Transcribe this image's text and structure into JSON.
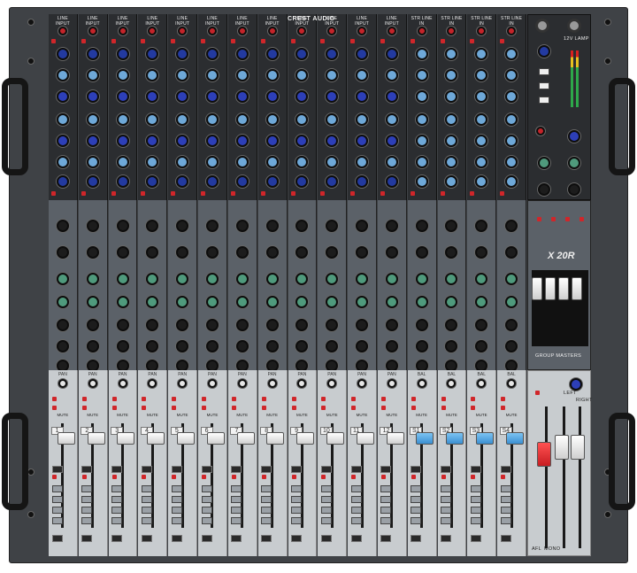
{
  "brand": {
    "logo_text": "CREST AUDIO",
    "model": "X 20R",
    "group_masters_label": "GROUP MASTERS"
  },
  "mono_channels": [
    {
      "number": "1",
      "top_label": "LINE INPUT",
      "pan_label": "PAN",
      "mute_label": "MUTE"
    },
    {
      "number": "2",
      "top_label": "LINE INPUT",
      "pan_label": "PAN",
      "mute_label": "MUTE"
    },
    {
      "number": "3",
      "top_label": "LINE INPUT",
      "pan_label": "PAN",
      "mute_label": "MUTE"
    },
    {
      "number": "4",
      "top_label": "LINE INPUT",
      "pan_label": "PAN",
      "mute_label": "MUTE"
    },
    {
      "number": "5",
      "top_label": "LINE INPUT",
      "pan_label": "PAN",
      "mute_label": "MUTE"
    },
    {
      "number": "6",
      "top_label": "LINE INPUT",
      "pan_label": "PAN",
      "mute_label": "MUTE"
    },
    {
      "number": "7",
      "top_label": "LINE INPUT",
      "pan_label": "PAN",
      "mute_label": "MUTE"
    },
    {
      "number": "8",
      "top_label": "LINE INPUT",
      "pan_label": "PAN",
      "mute_label": "MUTE"
    },
    {
      "number": "9",
      "top_label": "LINE INPUT",
      "pan_label": "PAN",
      "mute_label": "MUTE"
    },
    {
      "number": "10",
      "top_label": "LINE INPUT",
      "pan_label": "PAN",
      "mute_label": "MUTE"
    },
    {
      "number": "11",
      "top_label": "LINE INPUT",
      "pan_label": "PAN",
      "mute_label": "MUTE"
    },
    {
      "number": "12",
      "top_label": "LINE INPUT",
      "pan_label": "PAN",
      "mute_label": "MUTE"
    }
  ],
  "stereo_channels": [
    {
      "number": "S1",
      "top_label": "STR LINE IN",
      "pan_label": "BAL",
      "mute_label": "MUTE"
    },
    {
      "number": "S2",
      "top_label": "STR LINE IN",
      "pan_label": "BAL",
      "mute_label": "MUTE"
    },
    {
      "number": "S3",
      "top_label": "STR LINE IN",
      "pan_label": "BAL",
      "mute_label": "MUTE"
    },
    {
      "number": "S4",
      "top_label": "STR LINE IN",
      "pan_label": "BAL",
      "mute_label": "MUTE"
    }
  ],
  "master": {
    "lamp_label": "12V LAMP",
    "left_label": "LEFT",
    "right_label": "RIGHT",
    "afl_label": "AFL",
    "mono_label": "MONO"
  },
  "colors": {
    "faceplate_dark": "#2b2d30",
    "faceplate_mid": "#5b6168",
    "faceplate_light": "#c8cccf",
    "gain_knob": "#c4242a",
    "eq_knob_blue": "#2d3fb8",
    "aux_knob_green": "#4f9a7c",
    "stereo_fader": "#3b8fd1",
    "master_fader": "#c81d22"
  }
}
